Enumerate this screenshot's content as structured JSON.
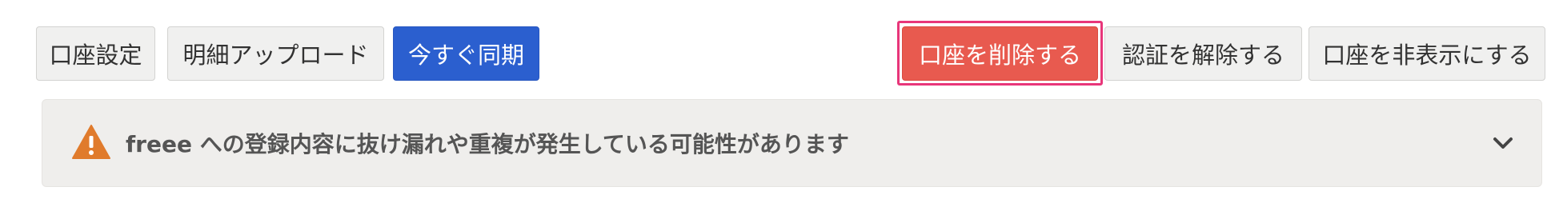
{
  "toolbar": {
    "left_buttons": {
      "account_settings": "口座設定",
      "upload_statement": "明細アップロード",
      "sync_now": "今すぐ同期"
    },
    "right_buttons": {
      "delete_account": "口座を削除する",
      "revoke_auth": "認証を解除する",
      "hide_account": "口座を非表示にする"
    }
  },
  "alert": {
    "icon": "warning-triangle-icon",
    "message": "freee への登録内容に抜け漏れや重複が発生している可能性があります",
    "toggle_icon": "chevron-down-icon"
  },
  "colors": {
    "primary": "#2b5fcf",
    "danger": "#e85a4f",
    "focus_ring": "#e8367a",
    "warning": "#e07b2c",
    "alert_bg": "#efeeec"
  }
}
